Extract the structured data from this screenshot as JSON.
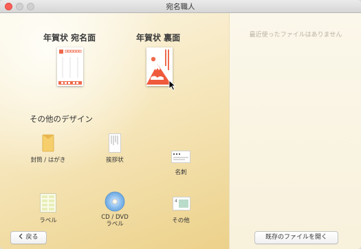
{
  "window": {
    "title": "宛名職人"
  },
  "main": {
    "nenga_front": {
      "label": "年賀状  宛名面"
    },
    "nenga_back": {
      "label": "年賀状  裏面"
    },
    "other_heading": "その他のデザイン",
    "items": [
      {
        "label": "封筒 / はがき",
        "icon": "envelope-icon"
      },
      {
        "label": "挨拶状",
        "icon": "greeting-card-icon"
      },
      {
        "label": "名刺",
        "icon": "business-card-icon"
      },
      {
        "label": "ラベル",
        "icon": "label-sheet-icon"
      },
      {
        "label": "CD / DVD",
        "label2": "ラベル",
        "icon": "cd-dvd-icon"
      },
      {
        "label": "その他",
        "icon": "other-icon"
      }
    ]
  },
  "sidebar": {
    "empty_message": "最近使ったファイルはありません"
  },
  "footer": {
    "back_label": "戻る",
    "back_icon": "chevron-left-icon",
    "open_label": "既存のファイルを開く"
  },
  "colors": {
    "accent_red": "#ef5a3c",
    "paper": "#f6efdc"
  }
}
